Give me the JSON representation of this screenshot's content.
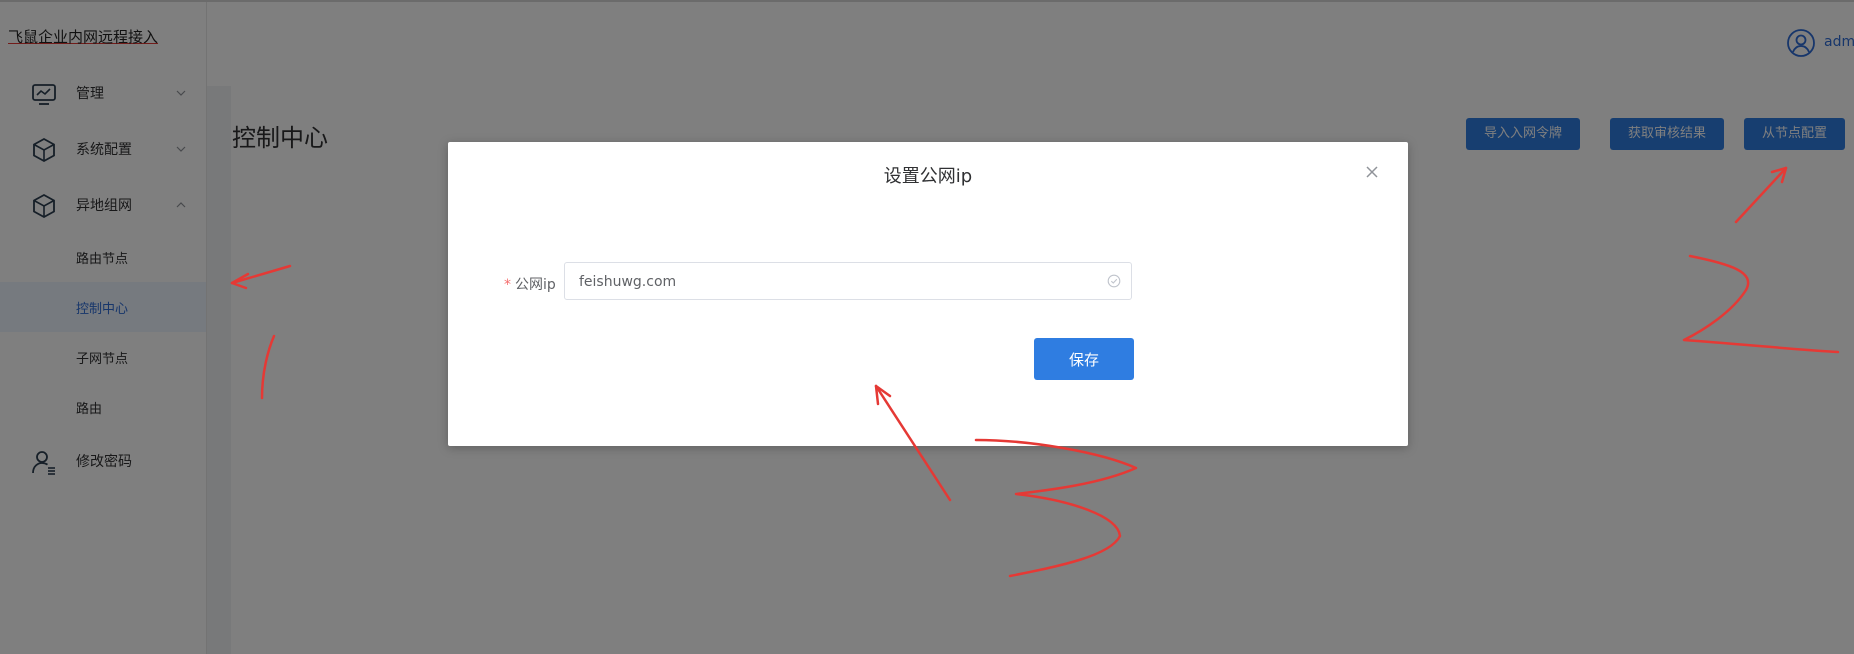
{
  "app": {
    "title": "飞鼠企业内网远程接入"
  },
  "header": {
    "user_name": "adm"
  },
  "sidebar": {
    "items": [
      {
        "label": "管理",
        "icon": "monitor-icon",
        "expanded": false
      },
      {
        "label": "系统配置",
        "icon": "cube-icon",
        "expanded": false
      },
      {
        "label": "异地组网",
        "icon": "cube-icon",
        "expanded": true
      },
      {
        "label": "路由节点"
      },
      {
        "label": "控制中心",
        "active": true
      },
      {
        "label": "子网节点"
      },
      {
        "label": "路由"
      },
      {
        "label": "修改密码",
        "icon": "user-settings-icon"
      }
    ]
  },
  "main": {
    "page_title": "控制中心",
    "buttons": [
      "导入入网令牌",
      "获取审核结果",
      "从节点配置"
    ]
  },
  "dialog": {
    "title": "设置公网ip",
    "field_label": "公网ip",
    "field_required_mark": "*",
    "field_value": "feishuwg.com",
    "save_label": "保存"
  },
  "colors": {
    "accent": "#2f7de1",
    "active_text": "#2f6cd6",
    "overlay": "rgba(0,0,0,0.5)",
    "annotation": "#e53935"
  }
}
